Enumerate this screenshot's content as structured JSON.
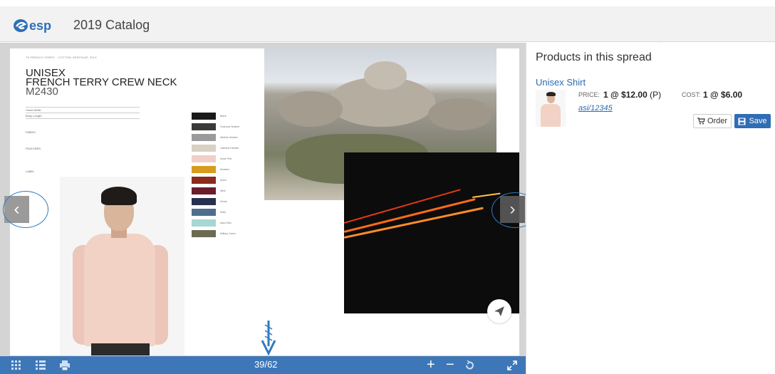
{
  "header": {
    "logo_text": "esp",
    "catalog_title": "2019 Catalog"
  },
  "spread": {
    "left_page": {
      "header_small": "75 FRENCH TERRY · COTTON HERITAGE 2019",
      "title_line1": "UNISEX",
      "title_line2": "FRENCH TERRY CREW NECK",
      "style_code": "M2430",
      "spec_rows": [
        "Chest Width",
        "Body Length"
      ],
      "fabric_label": "FABRIC",
      "features_label": "FEATURES",
      "label_label": "LABEL",
      "swatches": [
        {
          "name": "Black",
          "color": "#1a1a1a"
        },
        {
          "name": "Charcoal Heather",
          "color": "#3c3a38"
        },
        {
          "name": "Athletic Heather",
          "color": "#9a9a9c"
        },
        {
          "name": "Oatmeal Heather",
          "color": "#d8d0c2"
        },
        {
          "name": "Nude Pink",
          "color": "#f1cfc6"
        },
        {
          "name": "Mustard",
          "color": "#d89b1e"
        },
        {
          "name": "Spice",
          "color": "#8a2b1d"
        },
        {
          "name": "Wine",
          "color": "#6c1d2c"
        },
        {
          "name": "Denim",
          "color": "#283050"
        },
        {
          "name": "Slate",
          "color": "#4f6e8e"
        },
        {
          "name": "Aqua Mist",
          "color": "#a6d7d1"
        },
        {
          "name": "Military Green",
          "color": "#6b6b52"
        }
      ]
    }
  },
  "toolbar": {
    "page_indicator": "39/62",
    "icons": [
      "grid-view-icon",
      "list-view-icon",
      "print-icon",
      "zoom-in-icon",
      "zoom-out-icon",
      "reset-zoom-icon",
      "fullscreen-icon"
    ]
  },
  "sidebar": {
    "heading": "Products in this spread",
    "product": {
      "name": "Unisex Shirt",
      "price_label": "PRICE:",
      "price_value": "1 @ $12.00",
      "price_suffix": "(P)",
      "cost_label": "COST:",
      "cost_value": "1 @ $6.00",
      "asi": "asi/12345",
      "order_label": "Order",
      "save_label": "Save"
    }
  },
  "colors": {
    "brand_blue": "#2e6fb7",
    "toolbar_blue": "#3e77b8",
    "link_blue": "#2b6cb0"
  }
}
